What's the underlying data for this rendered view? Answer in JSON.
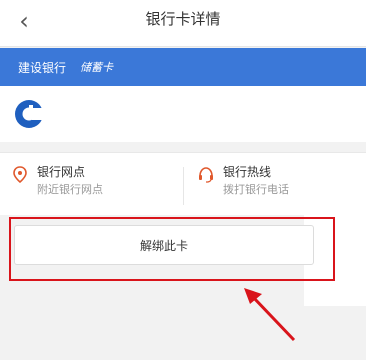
{
  "header": {
    "title": "银行卡详情",
    "back_icon": "chevron-left-icon"
  },
  "bank": {
    "name": "建设银行",
    "card_type": "储蓄卡",
    "bar_color": "#3b78d8",
    "logo_icon": "ccb-logo-icon",
    "logo_color": "#1f5fbf"
  },
  "services": [
    {
      "title": "银行网点",
      "subtitle": "附近银行网点",
      "icon": "map-pin-icon",
      "icon_color": "#e0582c"
    },
    {
      "title": "银行热线",
      "subtitle": "拨打银行电话",
      "icon": "headset-icon",
      "icon_color": "#e0582c"
    }
  ],
  "actions": {
    "unbind_label": "解绑此卡"
  },
  "annotation": {
    "color": "#d9141b"
  }
}
